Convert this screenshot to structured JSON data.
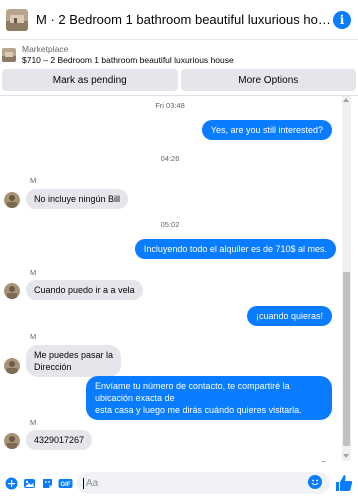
{
  "header": {
    "title": "M · 2 Bedroom 1 bathroom beautiful luxurious house",
    "info_icon": "info-icon"
  },
  "marketplace": {
    "label": "Marketplace",
    "item": "$710 – 2 Bedroom 1 bathroom beautiful luxurious house"
  },
  "actions": {
    "mark_pending": "Mark as pending",
    "more_options": "More Options"
  },
  "chat": {
    "timestamps": [
      "Fri 03:48",
      "04:26",
      "05:02"
    ],
    "sender_name": "M",
    "messages": [
      {
        "from": "me",
        "text": "Yes, are you still interested?"
      },
      {
        "from": "M",
        "text": "No incluye ningún Bill"
      },
      {
        "from": "me",
        "text": "Incluyendo todo el alquiler es de 710$ al mes."
      },
      {
        "from": "M",
        "text": "Cuando puedo ir a a vela"
      },
      {
        "from": "me",
        "text": "¡cuando quieras!"
      },
      {
        "from": "M",
        "lines": [
          "Me puedes pasar la",
          "Dirección"
        ]
      },
      {
        "from": "me",
        "lines": [
          "Envíame tu número de contacto, te compartiré la ubicación exacta de",
          "esta casa y luego me dirás cuándo quieres visitarla."
        ]
      },
      {
        "from": "M",
        "text": "4329017267"
      }
    ]
  },
  "composer": {
    "placeholder": "Aa",
    "icons": [
      "plus-circle-icon",
      "photo-icon",
      "sticker-icon",
      "gif-icon",
      "emoji-icon",
      "like-icon"
    ]
  },
  "colors": {
    "accent": "#0a7cff",
    "incoming_bubble": "#e4e6eb",
    "muted_text": "#65676b"
  }
}
